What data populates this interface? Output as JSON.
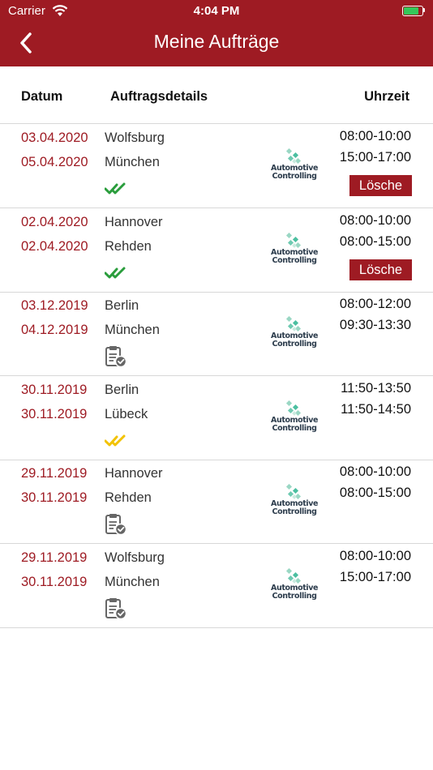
{
  "status_bar": {
    "carrier": "Carrier",
    "time": "4:04 PM"
  },
  "header": {
    "title": "Meine Aufträge"
  },
  "columns": {
    "date": "Datum",
    "details": "Auftragsdetails",
    "time": "Uhrzeit"
  },
  "logo": {
    "line1": "Automotive",
    "line2": "Controlling"
  },
  "colors": {
    "brand": "#9e1b23",
    "check_green": "#2a9d3c",
    "check_yellow": "#f2c200",
    "logo_green": "#4bbfa0"
  },
  "orders": [
    {
      "date1": "03.04.2020",
      "date2": "05.04.2020",
      "city1": "Wolfsburg",
      "city2": "München",
      "time1": "08:00-10:00",
      "time2": "15:00-17:00",
      "status_icon": "double-check-green-icon",
      "delete_label": "Lösche"
    },
    {
      "date1": "02.04.2020",
      "date2": "02.04.2020",
      "city1": "Hannover",
      "city2": "Rehden",
      "time1": "08:00-10:00",
      "time2": "08:00-15:00",
      "status_icon": "double-check-green-icon",
      "delete_label": "Lösche"
    },
    {
      "date1": "03.12.2019",
      "date2": "04.12.2019",
      "city1": "Berlin",
      "city2": "München",
      "time1": "08:00-12:00",
      "time2": "09:30-13:30",
      "status_icon": "clipboard-check-icon"
    },
    {
      "date1": "30.11.2019",
      "date2": "30.11.2019",
      "city1": "Berlin",
      "city2": "Lübeck",
      "time1": "11:50-13:50",
      "time2": "11:50-14:50",
      "status_icon": "double-check-yellow-icon"
    },
    {
      "date1": "29.11.2019",
      "date2": "30.11.2019",
      "city1": "Hannover",
      "city2": "Rehden",
      "time1": "08:00-10:00",
      "time2": "08:00-15:00",
      "status_icon": "clipboard-check-icon"
    },
    {
      "date1": "29.11.2019",
      "date2": "30.11.2019",
      "city1": "Wolfsburg",
      "city2": "München",
      "time1": "08:00-10:00",
      "time2": "15:00-17:00",
      "status_icon": "clipboard-check-icon"
    }
  ]
}
